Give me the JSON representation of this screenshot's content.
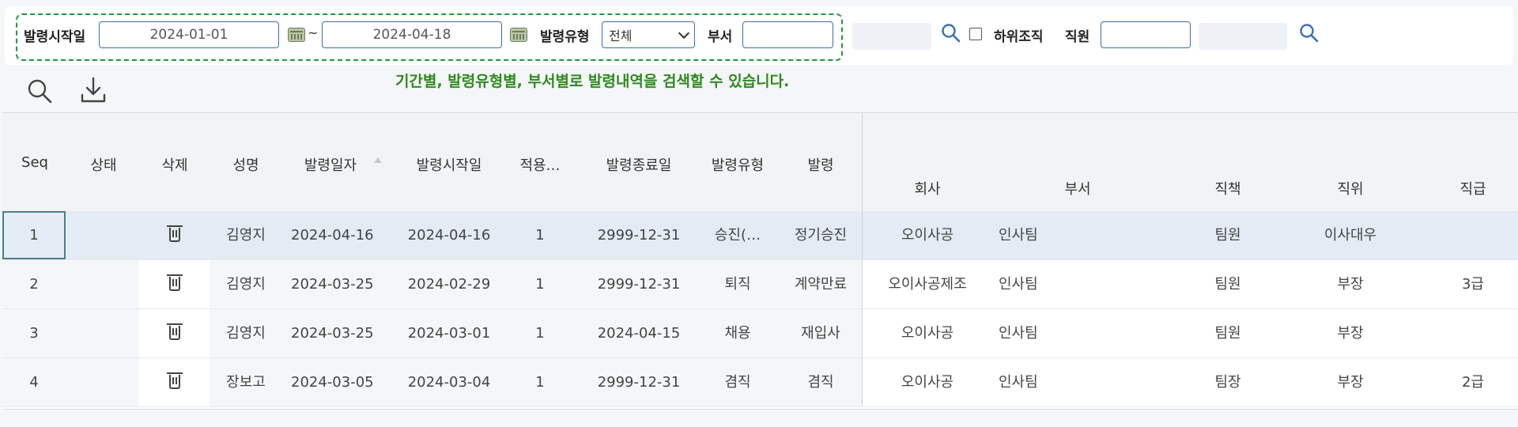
{
  "filters": {
    "start_label": "발령시작일",
    "start_date": "2024-01-01",
    "range_sep": "~",
    "end_date": "2024-04-18",
    "type_label": "발령유형",
    "type_value": "전체",
    "dept_label": "부서",
    "dept_value": "",
    "suborg_label": "하위조직",
    "suborg_checked": false,
    "employee_label": "직원",
    "employee_value": ""
  },
  "hint": "기간별, 발령유형별, 부서별로 발령내역을 검색할 수 있습니다.",
  "toolbar": {
    "search_icon": "search-icon",
    "download_icon": "download-icon"
  },
  "columns": {
    "seq": "Seq",
    "status": "상태",
    "delete": "삭제",
    "name": "성명",
    "issue_date": "발령일자",
    "start_date": "발령시작일",
    "apply": "적용…",
    "end_date": "발령종료일",
    "type": "발령유형",
    "order": "발령",
    "company": "회사",
    "dept": "부서",
    "duty": "직책",
    "position": "직위",
    "grade": "직급"
  },
  "rows": [
    {
      "seq": "1",
      "status": "",
      "name": "김영지",
      "issue_date": "2024-04-16",
      "start_date": "2024-04-16",
      "apply": "1",
      "end_date": "2999-12-31",
      "type": "승진(…",
      "order": "정기승진",
      "company": "오이사공",
      "dept": "인사팀",
      "duty": "팀원",
      "position": "이사대우",
      "grade": ""
    },
    {
      "seq": "2",
      "status": "",
      "name": "김영지",
      "issue_date": "2024-03-25",
      "start_date": "2024-02-29",
      "apply": "1",
      "end_date": "2999-12-31",
      "type": "퇴직",
      "order": "계약만료",
      "company": "오이사공제조",
      "dept": "인사팀",
      "duty": "팀원",
      "position": "부장",
      "grade": "3급"
    },
    {
      "seq": "3",
      "status": "",
      "name": "김영지",
      "issue_date": "2024-03-25",
      "start_date": "2024-03-01",
      "apply": "1",
      "end_date": "2024-04-15",
      "type": "채용",
      "order": "재입사",
      "company": "오이사공",
      "dept": "인사팀",
      "duty": "팀원",
      "position": "부장",
      "grade": ""
    },
    {
      "seq": "4",
      "status": "",
      "name": "장보고",
      "issue_date": "2024-03-05",
      "start_date": "2024-03-04",
      "apply": "1",
      "end_date": "2999-12-31",
      "type": "겸직",
      "order": "겸직",
      "company": "오이사공",
      "dept": "인사팀",
      "duty": "팀장",
      "position": "부장",
      "grade": "2급"
    }
  ],
  "colors": {
    "accent_border": "#3a6fb6",
    "hint_green": "#2f8a1e",
    "dash_green": "#1e9a3a",
    "selected_row": "#e3ecf5"
  }
}
